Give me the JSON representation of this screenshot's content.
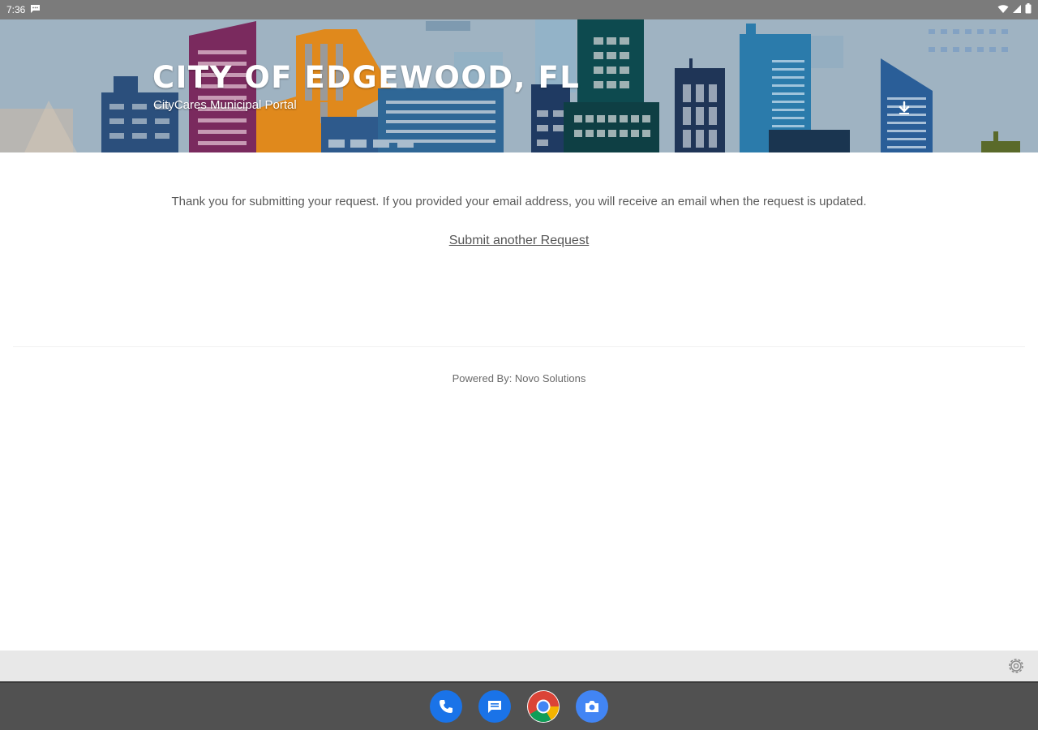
{
  "status_bar": {
    "time": "7:36",
    "icons": [
      "chat-notification-icon",
      "wifi-icon",
      "signal-icon",
      "battery-icon"
    ]
  },
  "header": {
    "title": "CITY OF EDGEWOOD, FL",
    "subtitle": "CityCares Municipal Portal",
    "download_icon": "download-arrow-icon"
  },
  "main": {
    "confirmation_message": "Thank you for submitting your request. If you provided your email address, you will receive an email when the request is updated.",
    "submit_another_label": "Submit another Request"
  },
  "footer": {
    "powered_by": "Powered By: Novo Solutions"
  },
  "bottom_strip": {
    "settings_icon": "gear-icon"
  },
  "dock": {
    "apps": [
      {
        "name": "phone",
        "icon": "phone-icon",
        "color": "#1a73e8"
      },
      {
        "name": "messages",
        "icon": "messages-icon",
        "color": "#1a73e8"
      },
      {
        "name": "chrome",
        "icon": "chrome-icon",
        "color": "#ffffff"
      },
      {
        "name": "camera",
        "icon": "camera-icon",
        "color": "#4285f4"
      }
    ]
  },
  "colors": {
    "status_bar_bg": "#7b7b7b",
    "nav_bar_bg": "#515151",
    "text_gray": "#5a5a5a"
  }
}
